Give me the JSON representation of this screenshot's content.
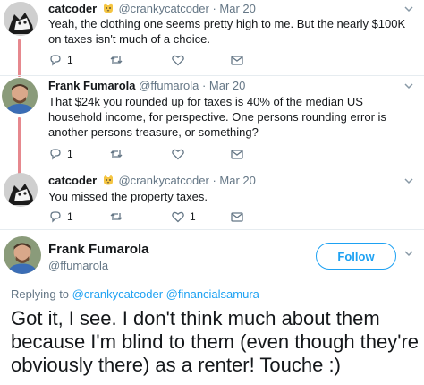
{
  "colors": {
    "thread_line": "#e6888e",
    "link": "#1da1f2",
    "muted": "#657786"
  },
  "tweets": [
    {
      "name": "catcoder",
      "handle": "@crankycatcoder",
      "dot": "·",
      "time": "Mar 20",
      "emoji": "cat-face-emoji",
      "text": "Yeah, the clothing one seems pretty high to me. But the nearly $100K on taxes isn't much of a choice.",
      "reply_count": "1",
      "retweet_count": "",
      "like_count": ""
    },
    {
      "name": "Frank Fumarola",
      "handle": "@ffumarola",
      "dot": "·",
      "time": "Mar 20",
      "text": "That $24k you rounded up for taxes is 40% of the median US household income, for perspective. One persons rounding error is another persons treasure, or something?",
      "reply_count": "1",
      "retweet_count": "",
      "like_count": ""
    },
    {
      "name": "catcoder",
      "handle": "@crankycatcoder",
      "dot": "·",
      "time": "Mar 20",
      "emoji": "cat-face-emoji",
      "text": "You missed the property taxes.",
      "reply_count": "1",
      "retweet_count": "",
      "like_count": "1"
    }
  ],
  "focus_tweet": {
    "name": "Frank Fumarola",
    "handle": "@ffumarola",
    "follow_label": "Follow",
    "replying_prefix": "Replying to",
    "mentions": [
      "@crankycatcoder",
      "@financialsamura"
    ],
    "text": "Got it, I see. I don't think much about them because I'm blind to them (even though they're obviously there) as a renter! Touche :)"
  }
}
